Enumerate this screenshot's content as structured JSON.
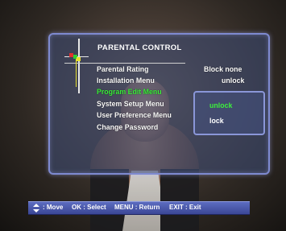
{
  "menu": {
    "title": "PARENTAL CONTROL",
    "items": [
      {
        "label": "Parental Rating",
        "value": "Block none"
      },
      {
        "label": "Installation Menu",
        "value": "unlock"
      },
      {
        "label": "Program Edit Menu",
        "value": "",
        "active": true
      },
      {
        "label": "System Setup Menu",
        "value": ""
      },
      {
        "label": "User Preference Menu",
        "value": ""
      },
      {
        "label": "Change Password",
        "value": ""
      }
    ]
  },
  "popup": {
    "options": [
      {
        "label": "unlock",
        "selected": true
      },
      {
        "label": "lock",
        "selected": false
      }
    ]
  },
  "hints": {
    "move": ": Move",
    "select": "OK : Select",
    "return": "MENU : Return",
    "exit": "EXIT : Exit"
  },
  "colors": {
    "active": "#3cf03c",
    "panel_border": "#7e8ad0",
    "hint_bar": "#4b58aa"
  }
}
